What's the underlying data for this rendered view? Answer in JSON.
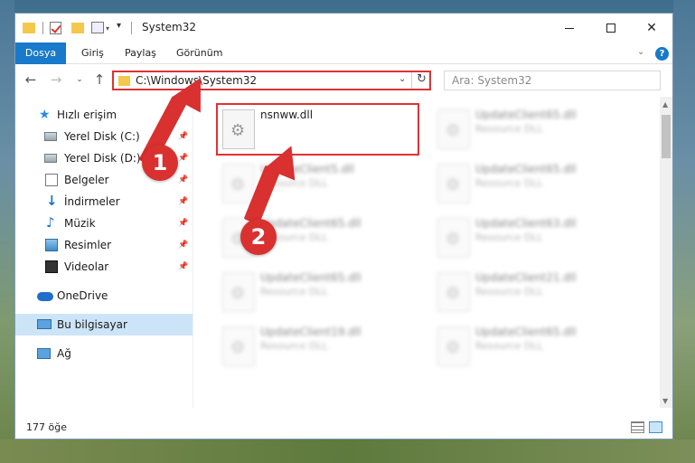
{
  "window": {
    "title": "System32"
  },
  "ribbon": {
    "tabs": [
      "Dosya",
      "Giriş",
      "Paylaş",
      "Görünüm"
    ],
    "help": "?"
  },
  "nav": {
    "back": "←",
    "forward": "→",
    "recent": "⌄",
    "up": "↑",
    "address": "C:\\Windows\\System32",
    "search_placeholder": "Ara: System32"
  },
  "sidebar": {
    "items": [
      {
        "label": "Hızlı erişim",
        "icon": "star-icon"
      },
      {
        "label": "Yerel Disk (C:)",
        "icon": "disk-icon",
        "pinned": true
      },
      {
        "label": "Yerel Disk (D:)",
        "icon": "disk-icon",
        "pinned": true
      },
      {
        "label": "Belgeler",
        "icon": "documents-icon",
        "pinned": true
      },
      {
        "label": "İndirmeler",
        "icon": "download-icon",
        "pinned": true
      },
      {
        "label": "Müzik",
        "icon": "music-icon",
        "pinned": true
      },
      {
        "label": "Resimler",
        "icon": "pictures-icon",
        "pinned": true
      },
      {
        "label": "Videolar",
        "icon": "videos-icon",
        "pinned": true
      },
      {
        "label": "OneDrive",
        "icon": "onedrive-icon"
      },
      {
        "label": "Bu bilgisayar",
        "icon": "computer-icon",
        "selected": true
      },
      {
        "label": "Ağ",
        "icon": "network-icon"
      }
    ]
  },
  "files": [
    {
      "name": "nsnww.dll",
      "desc": "",
      "highlight": true
    },
    {
      "name": "UpdateClient65.dll",
      "desc": "Resource DLL"
    },
    {
      "name": "UpdateClient5.dll",
      "desc": "Resource DLL"
    },
    {
      "name": "UpdateClient65.dll",
      "desc": "Resource DLL"
    },
    {
      "name": "UpdateClient65.dll",
      "desc": "Resource DLL"
    },
    {
      "name": "UpdateClient63.dll",
      "desc": "Resource DLL"
    },
    {
      "name": "UpdateClient65.dll",
      "desc": "Resource DLL"
    },
    {
      "name": "UpdateClient21.dll",
      "desc": "Resource DLL"
    },
    {
      "name": "UpdateClient19.dll",
      "desc": "Resource DLL"
    },
    {
      "name": "UpdateClient65.dll",
      "desc": "Resource DLL"
    }
  ],
  "status": {
    "count": "177 öğe"
  },
  "annotations": {
    "step1": "1",
    "step2": "2"
  },
  "colors": {
    "accent": "#1979ca",
    "highlight": "#e03232",
    "selected": "#cce4f7"
  }
}
